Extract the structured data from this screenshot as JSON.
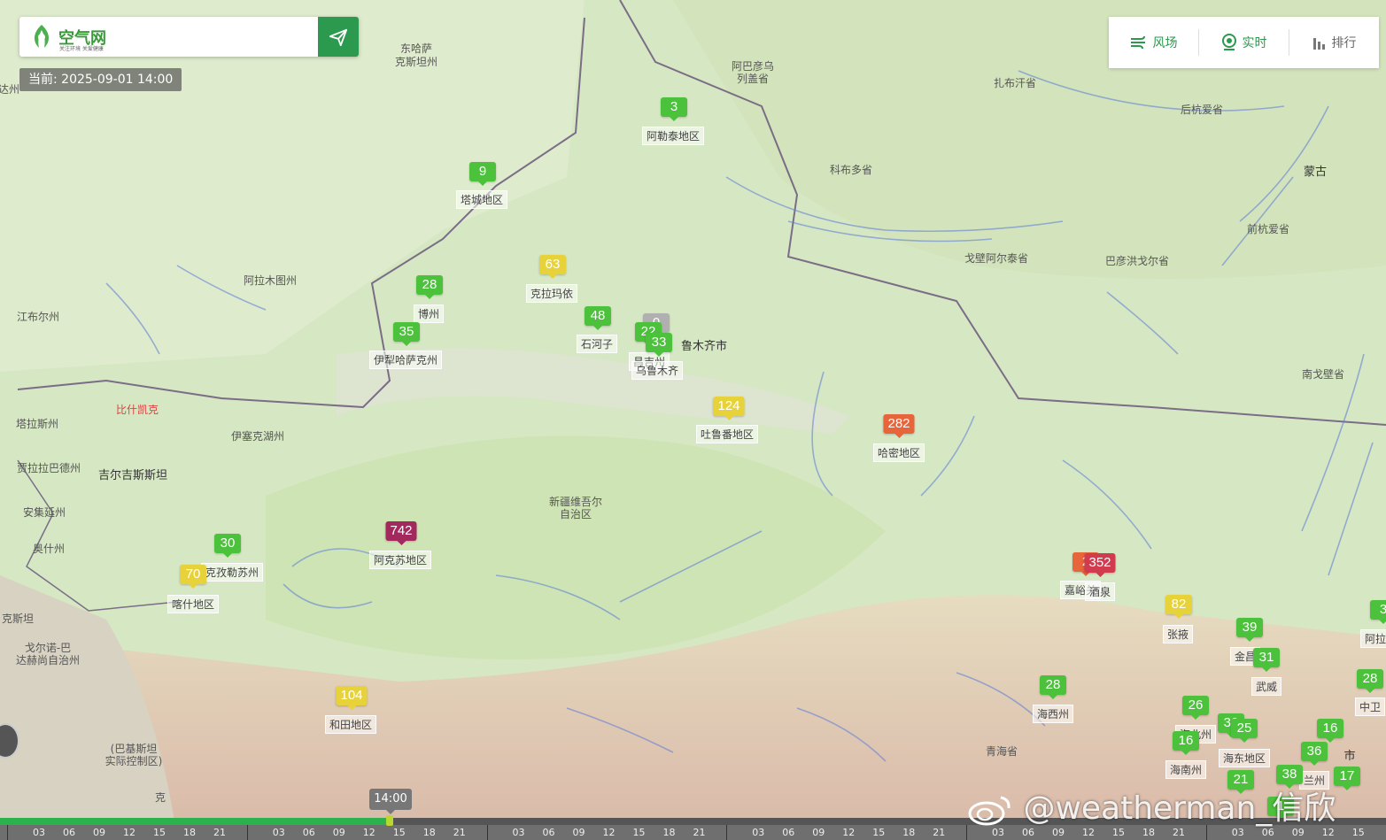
{
  "app": {
    "logo_name": "空气网",
    "logo_tagline": "关注环境 关爱健康",
    "search_placeholder": "",
    "current_time": "当前: 2025-09-01 14:00"
  },
  "toolbar": {
    "items": [
      {
        "label": "风场",
        "icon": "wind-icon",
        "active": true
      },
      {
        "label": "实时",
        "icon": "location-icon",
        "active": true
      },
      {
        "label": "排行",
        "icon": "bar-chart-icon",
        "active": false
      }
    ]
  },
  "colors": {
    "good": "#4cc13b",
    "moderate": "#e8d23a",
    "unhealthy": "#e8643a",
    "very_unhealthy": "#d23a4e",
    "hazardous": "#a3285e",
    "nodata": "#b0b0b0",
    "accent": "#2b9a4e"
  },
  "aqi_markers": [
    {
      "value": "3",
      "level": "good",
      "label": "阿勒泰地区"
    },
    {
      "value": "9",
      "level": "good",
      "label": "塔城地区"
    },
    {
      "value": "63",
      "level": "moderate",
      "label": "克拉玛依"
    },
    {
      "value": "28",
      "level": "good",
      "label": "博州"
    },
    {
      "value": "48",
      "level": "good",
      "label": "石河子"
    },
    {
      "value": "0",
      "level": "nodata",
      "label": ""
    },
    {
      "value": "22",
      "level": "good",
      "label": "昌吉州"
    },
    {
      "value": "33",
      "level": "good",
      "label": "乌鲁木齐"
    },
    {
      "value": "35",
      "level": "good",
      "label": "伊犁哈萨克州"
    },
    {
      "value": "124",
      "level": "moderate",
      "label": "吐鲁番地区"
    },
    {
      "value": "282",
      "level": "unhealthy",
      "label": "哈密地区"
    },
    {
      "value": "742",
      "level": "hazardous",
      "label": "阿克苏地区"
    },
    {
      "value": "30",
      "level": "good",
      "label": "克孜勒苏州"
    },
    {
      "value": "70",
      "level": "moderate",
      "label": "喀什地区"
    },
    {
      "value": "104",
      "level": "moderate",
      "label": "和田地区"
    },
    {
      "value": "2",
      "level": "unhealthy",
      "label": "嘉峪关"
    },
    {
      "value": "352",
      "level": "very_unhealthy",
      "label": "酒泉"
    },
    {
      "value": "82",
      "level": "moderate",
      "label": "张掖"
    },
    {
      "value": "39",
      "level": "good",
      "label": "金昌"
    },
    {
      "value": "31",
      "level": "good",
      "label": "武威"
    },
    {
      "value": "28",
      "level": "good",
      "label": "海西州"
    },
    {
      "value": "26",
      "level": "good",
      "label": "海北州"
    },
    {
      "value": "30",
      "level": "good",
      "label": ""
    },
    {
      "value": "25",
      "level": "good",
      "label": "海东地区"
    },
    {
      "value": "16",
      "level": "good",
      "label": "海南州"
    },
    {
      "value": "16",
      "level": "good",
      "label": ""
    },
    {
      "value": "36",
      "level": "good",
      "label": "兰州"
    },
    {
      "value": "38",
      "level": "good",
      "label": ""
    },
    {
      "value": "21",
      "level": "good",
      "label": ""
    },
    {
      "value": "17",
      "level": "good",
      "label": ""
    },
    {
      "value": "1",
      "level": "good",
      "label": ""
    },
    {
      "value": "28",
      "level": "good",
      "label": "中卫"
    },
    {
      "value": "3",
      "level": "good",
      "label": "阿拉"
    }
  ],
  "map_places": [
    "东哈萨",
    "克斯坦州",
    "阿巴彦乌",
    "列盖省",
    "扎布汗省",
    "后杭爱省",
    "科布多省",
    "蒙古",
    "前杭爱省",
    "戈壁阿尔泰省",
    "巴彦洪戈尔省",
    "南戈壁省",
    "阿拉木图州",
    "江布尔州",
    "比什凯克",
    "塔拉斯州",
    "伊塞克湖州",
    "贾拉拉巴德州",
    "吉尔吉斯斯坦",
    "安集延州",
    "奥什州",
    "新疆维吾尔",
    "自治区",
    "鲁木齐市",
    "青海省",
    "戈尔诺-巴",
    "达赫尚自治州",
    "克斯坦",
    "(巴基斯坦",
    "实际控制区)",
    "克",
    "达州",
    "市"
  ],
  "timeline": {
    "current_label": "14:00",
    "hours": [
      "03",
      "06",
      "09",
      "12",
      "15",
      "18",
      "21"
    ],
    "days": 6,
    "progress": 0.28
  },
  "watermark": "@weatherman_信欣"
}
